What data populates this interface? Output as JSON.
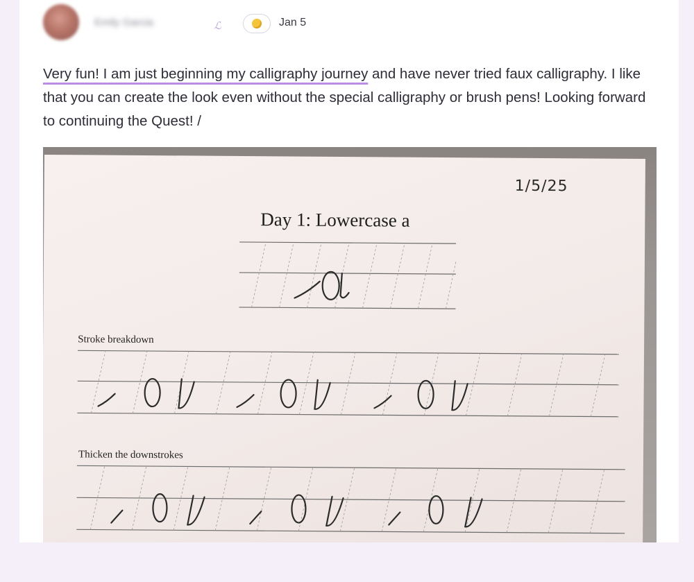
{
  "post": {
    "username": "Emily Garcia",
    "date": "Jan 5",
    "badge_icon": "calligraphy-badge-icon",
    "reaction_icon": "clapping-hands-icon",
    "text_highlight": "Very fun! I am just beginning my calligraphy journey",
    "text_rest": " and have never tried faux calligraphy. I like that you can create the look even without the special calligraphy or brush pens! Looking forward to continuing the Quest! /"
  },
  "worksheet": {
    "date": "1/5/25",
    "title": "Day 1: Lowercase a",
    "section1": "Stroke breakdown",
    "section2": "Thicken the downstrokes"
  },
  "colors": {
    "background": "#f4eff9",
    "highlight_underline": "#b98ee3",
    "text": "#2d2d38"
  }
}
